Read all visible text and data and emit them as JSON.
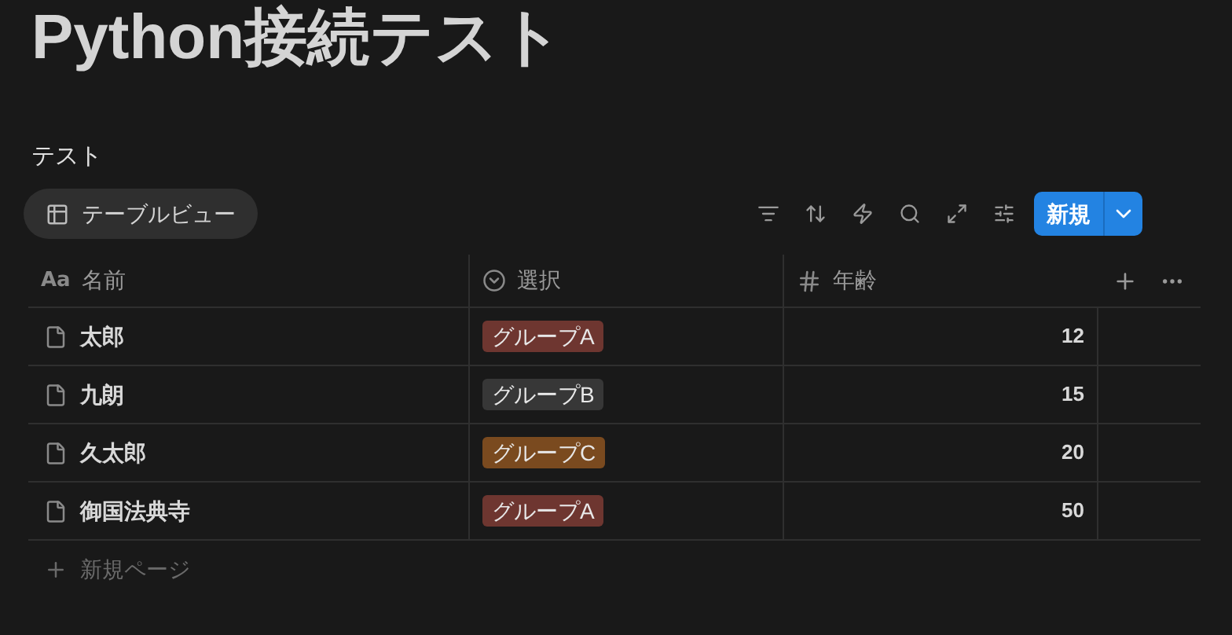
{
  "page_title": "Python接続テスト",
  "database": {
    "title": "テスト",
    "view_tab": "テーブルビュー",
    "new_button": "新規"
  },
  "table": {
    "columns": [
      {
        "kind": "title",
        "label": "名前",
        "type_glyph": "Aa"
      },
      {
        "kind": "select",
        "label": "選択"
      },
      {
        "kind": "number",
        "label": "年齢"
      }
    ],
    "rows": [
      {
        "name": "太郎",
        "tag": {
          "label": "グループA",
          "color": "#6e3630"
        },
        "age": "12"
      },
      {
        "name": "九朗",
        "tag": {
          "label": "グループB",
          "color": "#373737"
        },
        "age": "15"
      },
      {
        "name": "久太郎",
        "tag": {
          "label": "グループC",
          "color": "#7a4a1f"
        },
        "age": "20"
      },
      {
        "name": "御国法典寺",
        "tag": {
          "label": "グループA",
          "color": "#6e3630"
        },
        "age": "50"
      }
    ],
    "add_row": "新規ページ"
  }
}
